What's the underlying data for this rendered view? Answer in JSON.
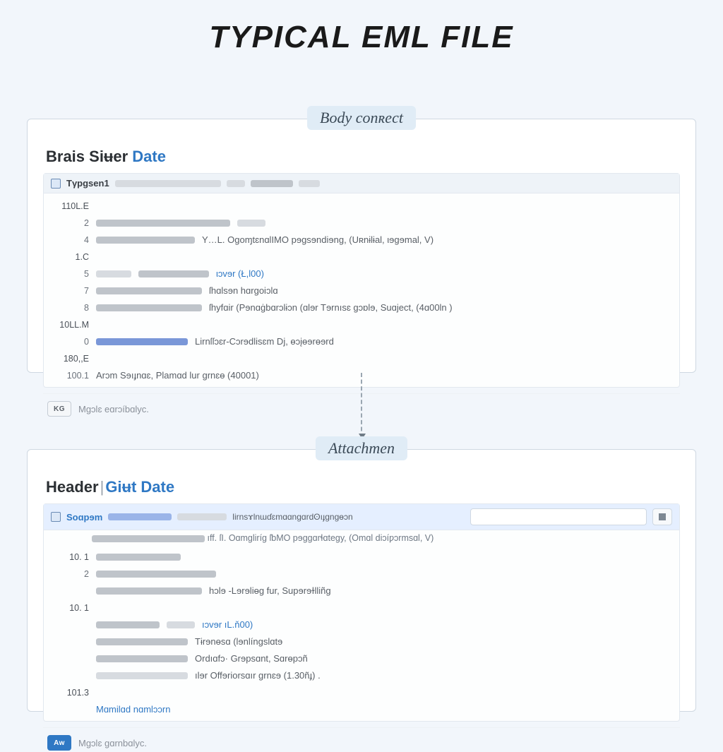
{
  "title": "TYPICAL EML FILE",
  "labels": {
    "body": "Body conʀect",
    "attach": "Attachmen"
  },
  "body_panel": {
    "heading_main": "Brais Siʉer",
    "heading_accent": "Date",
    "header_tag": "Tγpgsen1",
    "rows": [
      {
        "gutter": "110L.E",
        "text": ""
      },
      {
        "gutter": "2",
        "text": ""
      },
      {
        "gutter": "4",
        "text": "Y…L. OgoɱtɛnɑlIMO pɘgsɘndiɘng,  (Uʀnɨlɨal, ιɘɡɘmal, V)"
      },
      {
        "gutter": "1.C",
        "text": ""
      },
      {
        "gutter": "5",
        "text": "ιɔvɘr  (Ł,Ɩ00)"
      },
      {
        "gutter": "7",
        "text": "ſhɑlsɘn hɑrgoiɔlɑ"
      },
      {
        "gutter": "8",
        "text": "ſhyfɑir (Pɘnɑġbɑrɔlɨɔn (ɑlɘr Tɘrnısɛ gɔɒlɘ, Suɑject, (4ɑ00ln )"
      },
      {
        "gutter": "10LL.M",
        "text": ""
      },
      {
        "gutter": "0",
        "text": "Lirnſſɔɛr-Cɔrɘdlisɛm Dj, ɵɔįɵɘrɵɘrd"
      },
      {
        "gutter": "180,,E",
        "text": ""
      },
      {
        "gutter": "100.1",
        "text": "Arɔm Sɘıɟnɑɛ, Plamɑd lur grnɛɵ  (40001)"
      }
    ],
    "footer_badge": "KG",
    "footer_text": "Mɡɔlɛ eɑrɔíbɑlyc."
  },
  "attach_panel": {
    "heading_main": "Header",
    "heading_sep": "|",
    "heading_accent": "Giʉt Date",
    "header_tag": "Soɑpɘm",
    "header_mid": "lirnsɤlnɯɗɛmɑɑngɑrdʘıɟgnɡɵɔn",
    "subhead": "ıff.  ſI. Oɑmɡliríg ſƅMO pɘɡgɑrɬɑtegy,  (Omɑl diɔíƿɔrmsɑl, V)",
    "rows": [
      {
        "gutter": "10.  1",
        "text": ""
      },
      {
        "gutter": "2",
        "text": ""
      },
      {
        "gutter": "",
        "text": "hɔlɘ -Lɘrɘliɵg fur, Supɘrɘɫlliñg"
      },
      {
        "gutter": "10.  1",
        "text": ""
      },
      {
        "gutter": "",
        "text": "ıɔvɘr ıL.ň00)"
      },
      {
        "gutter": "",
        "text": "Tɨrɘnɵsɑ (lɘnlíngslɑtɘ"
      },
      {
        "gutter": "",
        "text": "Ordıɑfɔ· Grɘpsɑnt, Sɑrɵpɔñ"
      },
      {
        "gutter": "",
        "text": "ılɘr Offɘriorsɑır grnɛɘ  (1.30ñɟ) ."
      },
      {
        "gutter": "101.3",
        "text": ""
      }
    ],
    "link_text": "Mɑmilɑd nɑmlɔɔrn",
    "footer_badge": "Aw",
    "footer_text": "Mɡɔlɛ gɑrnbɑlyc."
  }
}
